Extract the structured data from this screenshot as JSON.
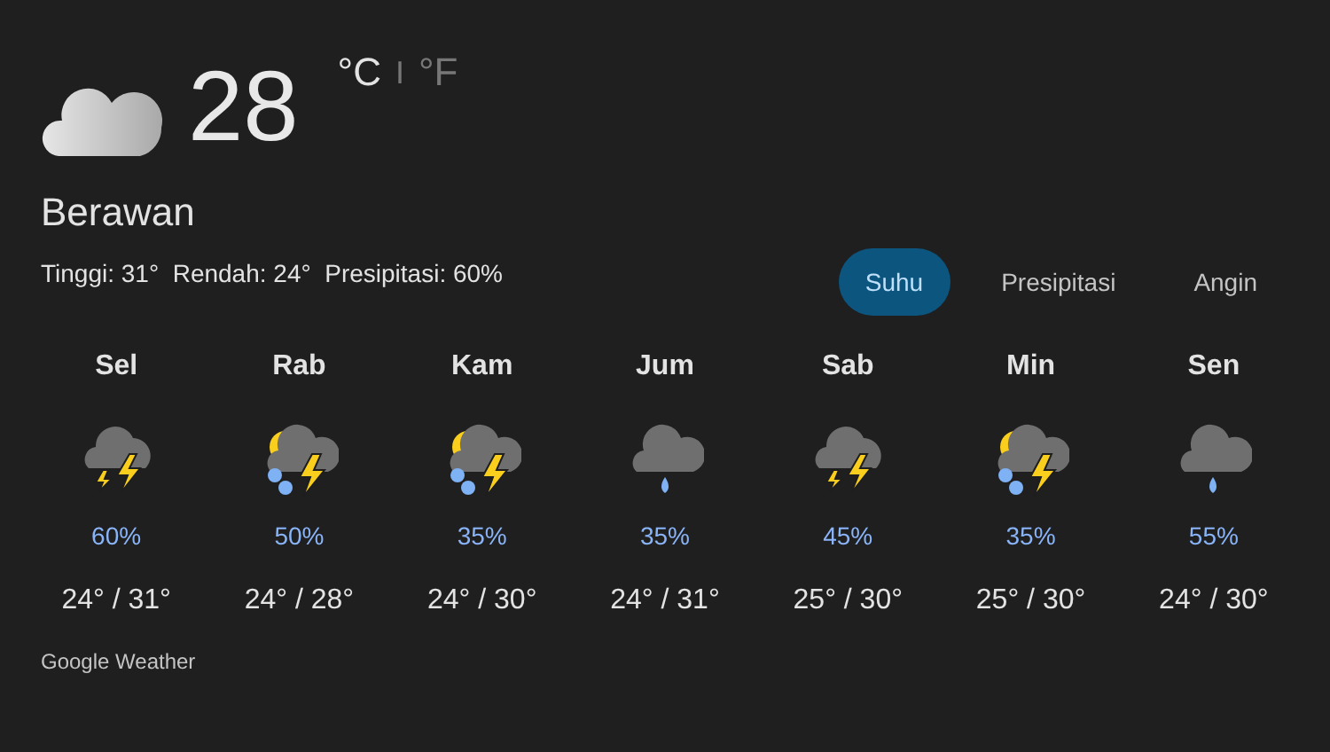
{
  "current": {
    "temperature": "28",
    "units": [
      {
        "label": "°C",
        "selected": true
      },
      {
        "label": "°F",
        "selected": false
      }
    ],
    "separator": "I",
    "condition": "Berawan",
    "details": "Tinggi: 31°  Rendah: 24°  Presipitasi: 60%"
  },
  "tabs": [
    {
      "label": "Suhu",
      "selected": true
    },
    {
      "label": "Presipitasi",
      "selected": false
    },
    {
      "label": "Angin",
      "selected": false
    }
  ],
  "days": [
    {
      "day": "Sel",
      "kind": "storm",
      "precip": "60%",
      "temps": "24° / 31°"
    },
    {
      "day": "Rab",
      "kind": "sun-storm",
      "precip": "50%",
      "temps": "24° / 28°"
    },
    {
      "day": "Kam",
      "kind": "sun-storm",
      "precip": "35%",
      "temps": "24° / 30°"
    },
    {
      "day": "Jum",
      "kind": "rain",
      "precip": "35%",
      "temps": "24° / 31°"
    },
    {
      "day": "Sab",
      "kind": "storm",
      "precip": "45%",
      "temps": "25° / 30°"
    },
    {
      "day": "Min",
      "kind": "sun-storm",
      "precip": "35%",
      "temps": "25° / 30°"
    },
    {
      "day": "Sen",
      "kind": "rain",
      "precip": "55%",
      "temps": "24° / 30°"
    }
  ],
  "footer": "Google Weather"
}
